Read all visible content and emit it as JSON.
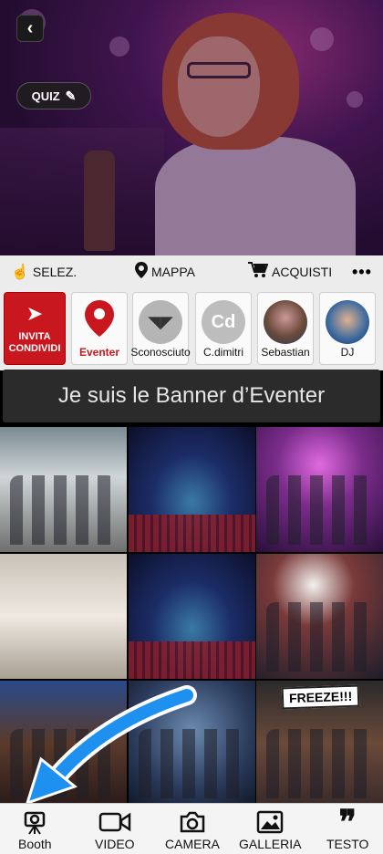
{
  "hero": {
    "quiz_label": "QUIZ"
  },
  "nav": {
    "selez_label": "SELEZ.",
    "mappa_label": "MAPPA",
    "acquisti_label": "ACQUISTI",
    "more_label": "•••"
  },
  "stories": {
    "invite_label_1": "INVITA",
    "invite_label_2": "CONDIVIDI",
    "items": [
      {
        "label": "Eventer"
      },
      {
        "label": "Sconosciuto"
      },
      {
        "label": "C.dimitri",
        "initials": "Cd"
      },
      {
        "label": "Sebastian"
      },
      {
        "label": "DJ"
      }
    ]
  },
  "banner": {
    "text": "Je suis le Banner d’Eventer"
  },
  "grid": {
    "freeze_text": "FREEZE!!!"
  },
  "bottom": {
    "booth": "Booth",
    "video": "VIDEO",
    "camera": "CAMERA",
    "galleria": "GALLERIA",
    "testo": "TESTO",
    "testo_glyph": "❞"
  },
  "colors": {
    "accent_red": "#c8171e",
    "arrow_blue": "#1e90f0"
  }
}
